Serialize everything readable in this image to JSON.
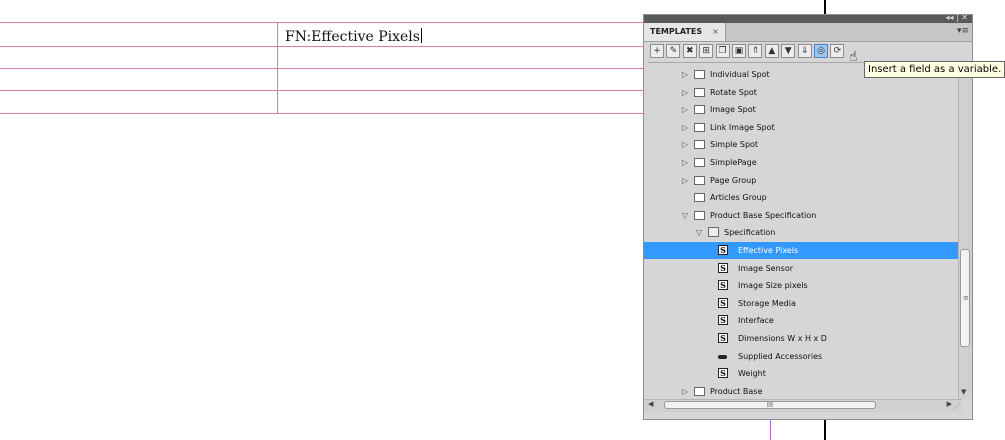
{
  "document": {
    "cell_text": "FN:Effective Pixels"
  },
  "panel": {
    "tab_label": "TEMPLATES",
    "tab_close": "×",
    "collapse_control": "◂◂ | ✕",
    "menu_icon": "▾≡"
  },
  "toolbar": {
    "buttons": [
      {
        "icon": "add-icon",
        "glyph": "+"
      },
      {
        "icon": "edit-icon",
        "glyph": "✎"
      },
      {
        "icon": "delete-icon",
        "glyph": "✖"
      },
      {
        "icon": "new-group-icon",
        "glyph": "⊞"
      },
      {
        "icon": "duplicate-icon",
        "glyph": "❐"
      },
      {
        "icon": "properties-icon",
        "glyph": "▣"
      },
      {
        "icon": "move-top-icon",
        "glyph": "⇑"
      },
      {
        "icon": "move-up-icon",
        "glyph": "▲"
      },
      {
        "icon": "move-down-icon",
        "glyph": "▼"
      },
      {
        "icon": "move-bottom-icon",
        "glyph": "⇓"
      },
      {
        "icon": "insert-variable-icon",
        "glyph": "◎"
      },
      {
        "icon": "refresh-icon",
        "glyph": "⟳"
      }
    ],
    "tooltip": "Insert a field as a variable."
  },
  "tree": [
    {
      "label": "Individual Spot",
      "expander": "▷",
      "type": "box",
      "depth": 0
    },
    {
      "label": "Rotate Spot",
      "expander": "▷",
      "type": "box",
      "depth": 0
    },
    {
      "label": "Image Spot",
      "expander": "▷",
      "type": "box",
      "depth": 0
    },
    {
      "label": "Link Image Spot",
      "expander": "▷",
      "type": "box",
      "depth": 0
    },
    {
      "label": "Simple Spot",
      "expander": "▷",
      "type": "box",
      "depth": 0
    },
    {
      "label": "SimplePage",
      "expander": "▷",
      "type": "box",
      "depth": 0
    },
    {
      "label": "Page Group",
      "expander": "▷",
      "type": "box",
      "depth": 0
    },
    {
      "label": "Articles Group",
      "expander": "",
      "type": "box",
      "depth": 0
    },
    {
      "label": "Product Base Specification",
      "expander": "▽",
      "type": "box",
      "depth": 0
    },
    {
      "label": "Specification",
      "expander": "▽",
      "type": "folder",
      "depth": 1
    },
    {
      "label": "Effective Pixels",
      "expander": "",
      "type": "s",
      "depth": 2,
      "selected": true
    },
    {
      "label": "Image Sensor",
      "expander": "",
      "type": "s",
      "depth": 2
    },
    {
      "label": "Image Size pixels",
      "expander": "",
      "type": "s",
      "depth": 2
    },
    {
      "label": "Storage Media",
      "expander": "",
      "type": "s",
      "depth": 2
    },
    {
      "label": "Interface",
      "expander": "",
      "type": "s",
      "depth": 2
    },
    {
      "label": "Dimensions W x H x D",
      "expander": "",
      "type": "s",
      "depth": 2
    },
    {
      "label": "Supplied Accessories",
      "expander": "",
      "type": "pill",
      "depth": 2
    },
    {
      "label": "Weight",
      "expander": "",
      "type": "s",
      "depth": 2
    },
    {
      "label": "Product Base",
      "expander": "▷",
      "type": "box",
      "depth": 0
    }
  ],
  "scrollbars": {
    "h_thumb_grip": "III",
    "v_thumb_grip": "≡"
  }
}
